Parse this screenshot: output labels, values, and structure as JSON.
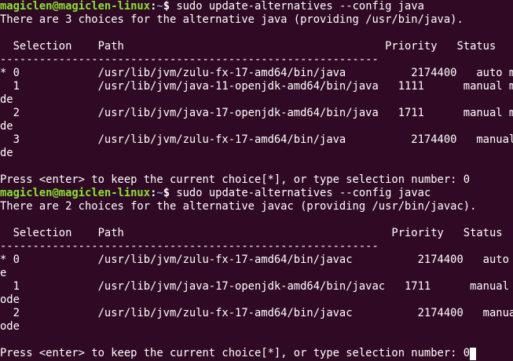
{
  "prompt": {
    "user": "magiclen@magiclen-linux",
    "path": "~",
    "symbol": "$"
  },
  "block_java": {
    "command": "sudo update-alternatives --config java",
    "intro": "There are 3 choices for the alternative java (providing /usr/bin/java).",
    "header": "  Selection    Path                                        Priority   Status",
    "divider": "------------------------------------------------------------",
    "rows": [
      "* 0            /usr/lib/jvm/zulu-fx-17-amd64/bin/java          2174400   auto mode",
      "  1            /usr/lib/jvm/java-11-openjdk-amd64/bin/java   1111      manual mo",
      "de",
      "  2            /usr/lib/jvm/java-17-openjdk-amd64/bin/java   1711      manual mo",
      "de",
      "  3            /usr/lib/jvm/zulu-fx-17-amd64/bin/java          2174400   manual mo",
      "de"
    ],
    "footer": "Press <enter> to keep the current choice[*], or type selection number: 0"
  },
  "block_javac": {
    "command": "sudo update-alternatives --config javac",
    "intro": "There are 2 choices for the alternative javac (providing /usr/bin/javac).",
    "header": "  Selection    Path                                         Priority   Status",
    "divider": "------------------------------------------------------------",
    "rows": [
      "* 0            /usr/lib/jvm/zulu-fx-17-amd64/bin/javac          2174400   auto mod",
      "e",
      "  1            /usr/lib/jvm/java-17-openjdk-amd64/bin/javac   1711      manual m",
      "ode",
      "  2            /usr/lib/jvm/zulu-fx-17-amd64/bin/javac          2174400   manual m",
      "ode"
    ],
    "footer": "Press <enter> to keep the current choice[*], or type selection number: 0"
  },
  "colors": {
    "background": "#300a24",
    "text": "#ffffff",
    "prompt_user": "#8ae234",
    "prompt_path": "#729fcf"
  }
}
